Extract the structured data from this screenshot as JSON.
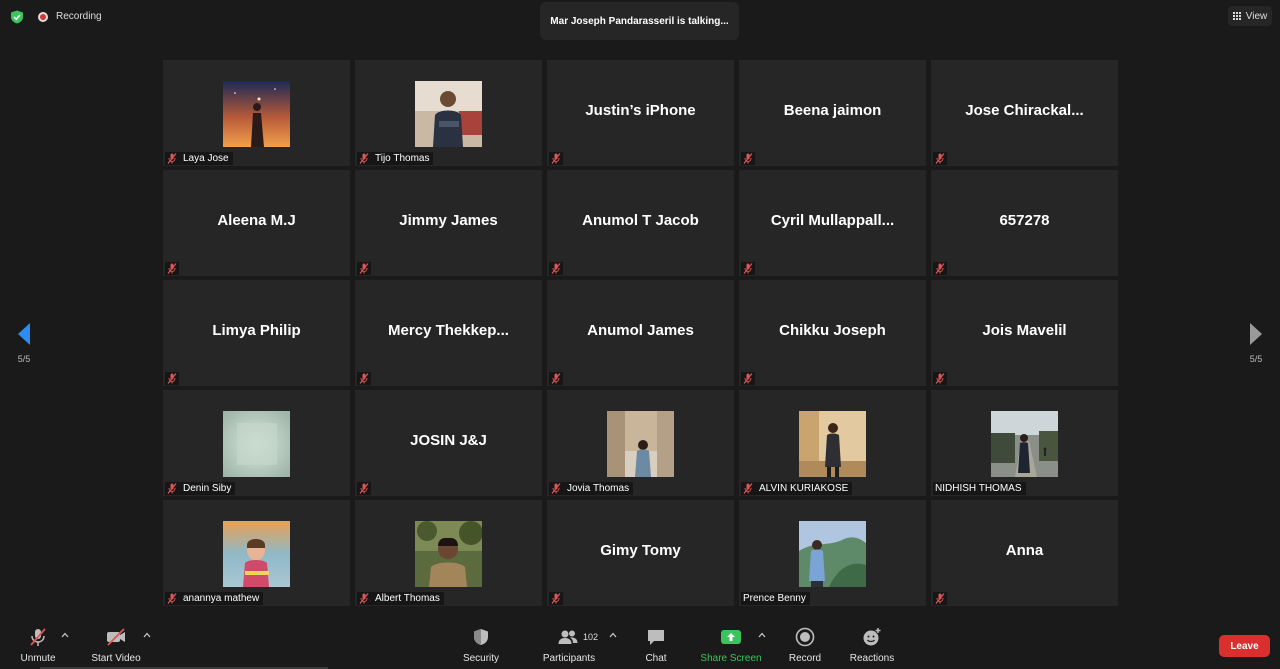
{
  "window": {
    "recording_label": "Recording",
    "talking_banner": "Mar Joseph Pandarasseril is talking...",
    "view_label": "View"
  },
  "pagination": {
    "left": "5/5",
    "right": "5/5"
  },
  "colors": {
    "tile_bg": "#262626",
    "muted_red": "#e05656",
    "share_green": "#3ac55c",
    "leave_red": "#d92f2f",
    "nav_blue": "#2d8cf0"
  },
  "participants": [
    {
      "name": "Laya Jose",
      "video": true,
      "muted": true,
      "photo": "sunset-girl"
    },
    {
      "name": "Tijo Thomas",
      "video": true,
      "muted": true,
      "photo": "man-bench"
    },
    {
      "name": "Justin’s iPhone",
      "video": false,
      "muted": true
    },
    {
      "name": "Beena jaimon",
      "video": false,
      "muted": true
    },
    {
      "name": "Jose  Chirackal...",
      "video": false,
      "muted": true
    },
    {
      "name": "Aleena M.J",
      "video": false,
      "muted": true
    },
    {
      "name": "Jimmy James",
      "video": false,
      "muted": true
    },
    {
      "name": "Anumol T Jacob",
      "video": false,
      "muted": true
    },
    {
      "name": "Cyril  Mullappall...",
      "video": false,
      "muted": true
    },
    {
      "name": "657278",
      "video": false,
      "muted": true
    },
    {
      "name": "Limya Philip",
      "video": false,
      "muted": true
    },
    {
      "name": "Mercy  Thekkep...",
      "video": false,
      "muted": true
    },
    {
      "name": "Anumol James",
      "video": false,
      "muted": true
    },
    {
      "name": "Chikku Joseph",
      "video": false,
      "muted": true
    },
    {
      "name": "Jois Mavelil",
      "video": false,
      "muted": true
    },
    {
      "name": "Denin Siby",
      "video": true,
      "muted": true,
      "photo": "blurred"
    },
    {
      "name": "JOSIN J&J",
      "video": false,
      "muted": true
    },
    {
      "name": "Jovia Thomas",
      "video": true,
      "muted": true,
      "photo": "girl-street"
    },
    {
      "name": "ALVIN KURIAKOSE",
      "video": true,
      "muted": true,
      "photo": "man-wall"
    },
    {
      "name": "NIDHISH THOMAS",
      "video": true,
      "muted": false,
      "photo": "man-road"
    },
    {
      "name": "anannya mathew",
      "video": true,
      "muted": true,
      "photo": "child"
    },
    {
      "name": "Albert Thomas",
      "video": true,
      "muted": true,
      "photo": "man-forest"
    },
    {
      "name": "Gimy Tomy",
      "video": false,
      "muted": true
    },
    {
      "name": "Prence Benny",
      "video": true,
      "muted": false,
      "photo": "man-hills"
    },
    {
      "name": "Anna",
      "video": false,
      "muted": true
    }
  ],
  "toolbar": {
    "unmute": "Unmute",
    "start_video": "Start Video",
    "security": "Security",
    "participants": "Participants",
    "participants_count": "102",
    "chat": "Chat",
    "share_screen": "Share Screen",
    "record": "Record",
    "reactions": "Reactions",
    "leave": "Leave"
  }
}
